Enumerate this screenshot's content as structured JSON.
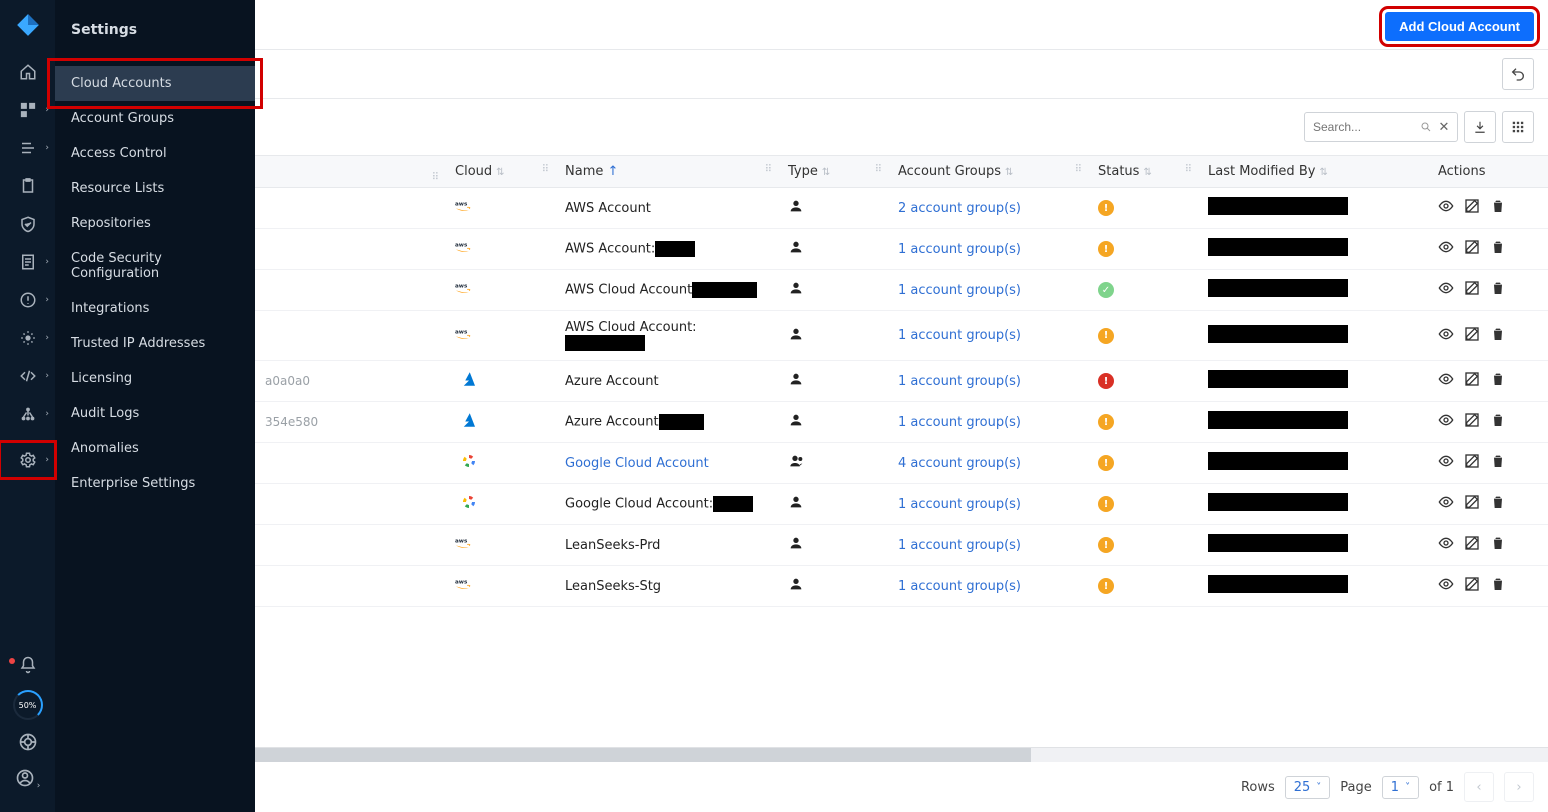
{
  "sidebar": {
    "title": "Settings",
    "items": [
      {
        "label": "Cloud Accounts",
        "active": true
      },
      {
        "label": "Account Groups"
      },
      {
        "label": "Access Control"
      },
      {
        "label": "Resource Lists"
      },
      {
        "label": "Repositories"
      },
      {
        "label": "Code Security Configuration"
      },
      {
        "label": "Integrations"
      },
      {
        "label": "Trusted IP Addresses"
      },
      {
        "label": "Licensing"
      },
      {
        "label": "Audit Logs"
      },
      {
        "label": "Anomalies"
      },
      {
        "label": "Enterprise Settings"
      }
    ]
  },
  "ring_label": "50%",
  "header": {
    "add_btn": "Add Cloud Account",
    "search_placeholder": "Search..."
  },
  "table": {
    "columns": {
      "cloud": "Cloud",
      "name": "Name",
      "type": "Type",
      "groups": "Account Groups",
      "status": "Status",
      "modified": "Last Modified By",
      "actions": "Actions"
    },
    "rows": [
      {
        "frag": "",
        "cloud": "aws",
        "name": "AWS Account",
        "redactW": 0,
        "link": false,
        "type": "user",
        "groups": "2 account group(s)",
        "status": "warn"
      },
      {
        "frag": "",
        "cloud": "aws",
        "name": "AWS Account:",
        "redactW": 40,
        "link": false,
        "type": "user",
        "groups": "1 account group(s)",
        "status": "warn"
      },
      {
        "frag": "",
        "cloud": "aws",
        "name": "AWS Cloud Account",
        "redactW": 65,
        "link": false,
        "type": "user",
        "groups": "1 account group(s)",
        "status": "ok"
      },
      {
        "frag": "",
        "cloud": "aws",
        "name": "AWS Cloud Account:",
        "redactW": 80,
        "link": false,
        "type": "user",
        "groups": "1 account group(s)",
        "status": "warn"
      },
      {
        "frag": "a0a0a0",
        "cloud": "azure",
        "name": "Azure Account",
        "redactW": 0,
        "link": false,
        "type": "user",
        "groups": "1 account group(s)",
        "status": "err"
      },
      {
        "frag": "354e580",
        "cloud": "azure",
        "name": "Azure Account",
        "redactW": 45,
        "link": false,
        "type": "user",
        "groups": "1 account group(s)",
        "status": "warn"
      },
      {
        "frag": "",
        "cloud": "gcp",
        "name": "Google Cloud Account",
        "redactW": 0,
        "link": true,
        "type": "users",
        "groups": "4 account group(s)",
        "status": "warn"
      },
      {
        "frag": "",
        "cloud": "gcp",
        "name": "Google Cloud Account:",
        "redactW": 40,
        "link": false,
        "type": "user",
        "groups": "1 account group(s)",
        "status": "warn"
      },
      {
        "frag": "",
        "cloud": "aws",
        "name": "LeanSeeks-Prd",
        "redactW": 0,
        "link": false,
        "type": "user",
        "groups": "1 account group(s)",
        "status": "warn"
      },
      {
        "frag": "",
        "cloud": "aws",
        "name": "LeanSeeks-Stg",
        "redactW": 0,
        "link": false,
        "type": "user",
        "groups": "1 account group(s)",
        "status": "warn"
      }
    ]
  },
  "pager": {
    "rows_label": "Rows",
    "rows_value": "25",
    "page_label": "Page",
    "page_value": "1",
    "of_label": "of 1"
  }
}
